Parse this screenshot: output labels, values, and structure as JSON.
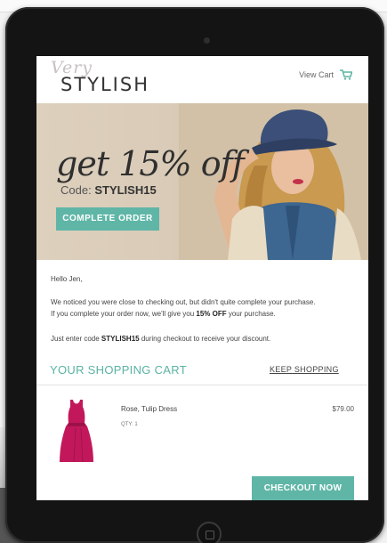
{
  "brand": {
    "logo_script": "Very",
    "logo_main": "STYLISH"
  },
  "header": {
    "view_cart_label": "View Cart",
    "cart_icon": "shopping-cart-icon"
  },
  "hero": {
    "headline": "get 15% off",
    "code_prefix": "Code:",
    "code": "STYLISH15",
    "cta_label": "COMPLETE ORDER"
  },
  "message": {
    "greeting": "Hello Jen,",
    "line1": "We noticed you were close to checking out, but didn't quite complete your purchase.",
    "line2_a": "If you complete your order now, we'll give you ",
    "line2_bold": "15% OFF",
    "line2_b": " your purchase.",
    "line3_a": "Just enter code ",
    "line3_bold": "STYLISH15",
    "line3_b": " during checkout to receive your discount."
  },
  "cart": {
    "heading": "YOUR SHOPPING CART",
    "keep_shopping_label": "KEEP SHOPPING",
    "items": [
      {
        "name": "Rose, Tulip Dress",
        "qty": "QTY: 1",
        "price": "$79.00"
      }
    ],
    "checkout_label": "CHECKOUT NOW"
  },
  "colors": {
    "accent": "#5fb6a7",
    "dress": "#c2185b"
  }
}
